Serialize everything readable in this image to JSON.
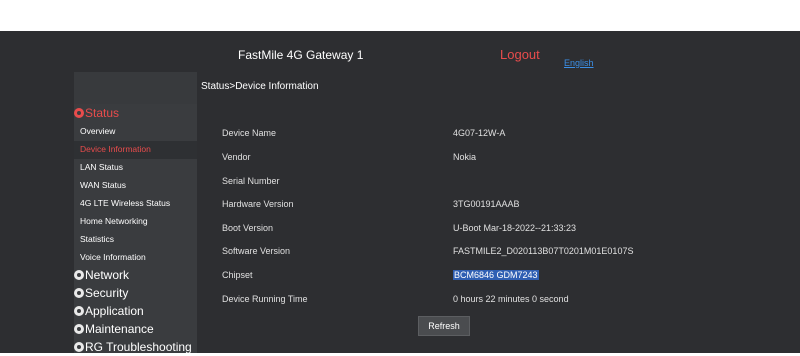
{
  "header": {
    "gateway_title": "FastMile 4G Gateway 1",
    "logout_label": "Logout",
    "language_label": "English"
  },
  "breadcrumb": "Status>Device Information",
  "sidebar": {
    "status_label": "Status",
    "status_items": [
      "Overview",
      "Device Information",
      "LAN Status",
      "WAN Status",
      "4G LTE Wireless Status",
      "Home Networking",
      "Statistics",
      "Voice Information"
    ],
    "categories": [
      "Network",
      "Security",
      "Application",
      "Maintenance",
      "RG Troubleshooting"
    ],
    "active_item": "Device Information"
  },
  "device_info": [
    {
      "label": "Device Name",
      "value": "4G07-12W-A"
    },
    {
      "label": "Vendor",
      "value": "Nokia"
    },
    {
      "label": "Serial Number",
      "value": ""
    },
    {
      "label": "Hardware Version",
      "value": "3TG00191AAAB"
    },
    {
      "label": "Boot Version",
      "value": "U-Boot Mar-18-2022--21:33:23"
    },
    {
      "label": "Software Version",
      "value": "FASTMILE2_D020113B07T0201M01E0107S"
    },
    {
      "label": "Chipset",
      "value": "BCM6846 GDM7243"
    },
    {
      "label": "Device Running Time",
      "value": "0 hours 22 minutes 0 second"
    }
  ],
  "refresh_label": "Refresh",
  "colors": {
    "background": "#2d2e31",
    "sidebar": "#3a3c3f",
    "accent_red": "#e84c4c",
    "link_blue": "#3b8fe6",
    "selection": "#2f5fb3"
  }
}
